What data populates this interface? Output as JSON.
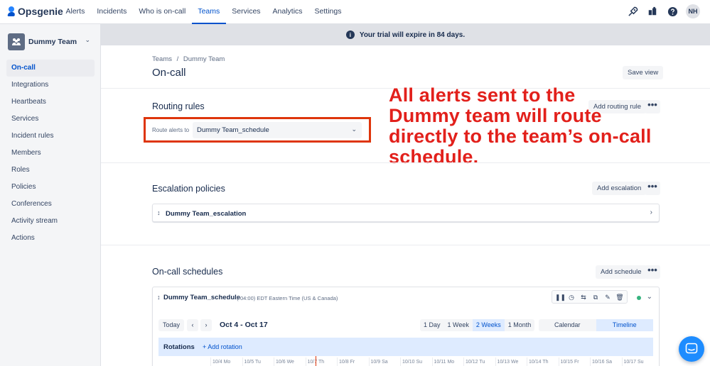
{
  "app": {
    "name": "Opsgenie"
  },
  "nav": {
    "items": [
      {
        "label": "Alerts"
      },
      {
        "label": "Incidents"
      },
      {
        "label": "Who is on-call"
      },
      {
        "label": "Teams",
        "active": true
      },
      {
        "label": "Services"
      },
      {
        "label": "Analytics"
      },
      {
        "label": "Settings"
      }
    ],
    "right_icons": [
      "rocket-icon",
      "marketplace-icon",
      "help-icon"
    ],
    "avatar_initials": "NH"
  },
  "sidebar": {
    "team_name": "Dummy Team",
    "items": [
      {
        "label": "On-call",
        "active": true
      },
      {
        "label": "Integrations"
      },
      {
        "label": "Heartbeats"
      },
      {
        "label": "Services"
      },
      {
        "label": "Incident rules"
      },
      {
        "label": "Members"
      },
      {
        "label": "Roles"
      },
      {
        "label": "Policies"
      },
      {
        "label": "Conferences"
      },
      {
        "label": "Activity stream"
      },
      {
        "label": "Actions"
      }
    ]
  },
  "banner": {
    "text": "Your trial will expire in 84 days."
  },
  "header": {
    "breadcrumb_root": "Teams",
    "breadcrumb_sep": "/",
    "breadcrumb_current": "Dummy Team",
    "title": "On-call",
    "save_view_label": "Save view"
  },
  "routing": {
    "title": "Routing rules",
    "add_label": "Add routing rule",
    "route_label": "Route alerts to",
    "selected": "Dummy Team_schedule"
  },
  "annotation": {
    "text": "All alerts sent to the Dummy team will route directly to the team’s on-call schedule.",
    "color": "#e2201b"
  },
  "escalation": {
    "title": "Escalation policies",
    "add_label": "Add escalation",
    "item_name": "Dummy Team_escalation"
  },
  "schedules": {
    "title": "On-call schedules",
    "add_label": "Add schedule",
    "name": "Dummy Team_schedule",
    "timezone": "(-04:00) EDT Eastern Time (US & Canada)",
    "status_color": "#36b37e",
    "today_label": "Today",
    "date_range": "Oct 4 - Oct 17",
    "ranges": [
      {
        "label": "1 Day"
      },
      {
        "label": "1 Week"
      },
      {
        "label": "2 Weeks",
        "selected": true
      },
      {
        "label": "1 Month"
      }
    ],
    "views": [
      {
        "label": "Calendar"
      },
      {
        "label": "Timeline",
        "selected": true
      }
    ],
    "rotations_label": "Rotations",
    "add_rotation_label": "+ Add rotation",
    "days": [
      "10/4 Mo",
      "10/5 Tu",
      "10/6 We",
      "10/7 Th",
      "10/8 Fr",
      "10/9 Sa",
      "10/10 Su",
      "10/11 Mo",
      "10/12 Tu",
      "10/13 We",
      "10/14 Th",
      "10/15 Fr",
      "10/16 Sa",
      "10/17 Su"
    ]
  },
  "colors": {
    "brand": "#0052cc",
    "highlight": "#de350b",
    "chat": "#1d8cff"
  }
}
